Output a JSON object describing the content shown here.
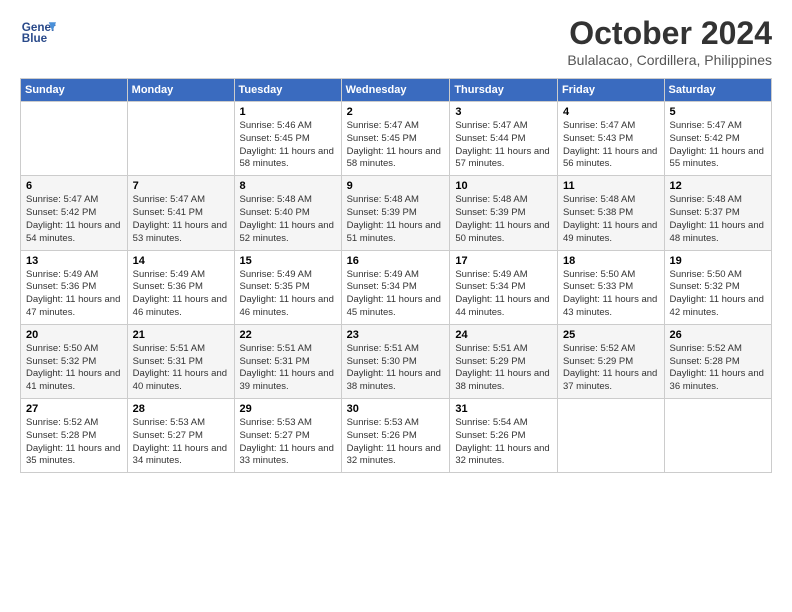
{
  "header": {
    "logo_line1": "General",
    "logo_line2": "Blue",
    "title": "October 2024",
    "location": "Bulalacao, Cordillera, Philippines"
  },
  "weekdays": [
    "Sunday",
    "Monday",
    "Tuesday",
    "Wednesday",
    "Thursday",
    "Friday",
    "Saturday"
  ],
  "weeks": [
    [
      {
        "day": "",
        "info": ""
      },
      {
        "day": "",
        "info": ""
      },
      {
        "day": "1",
        "info": "Sunrise: 5:46 AM\nSunset: 5:45 PM\nDaylight: 11 hours and 58 minutes."
      },
      {
        "day": "2",
        "info": "Sunrise: 5:47 AM\nSunset: 5:45 PM\nDaylight: 11 hours and 58 minutes."
      },
      {
        "day": "3",
        "info": "Sunrise: 5:47 AM\nSunset: 5:44 PM\nDaylight: 11 hours and 57 minutes."
      },
      {
        "day": "4",
        "info": "Sunrise: 5:47 AM\nSunset: 5:43 PM\nDaylight: 11 hours and 56 minutes."
      },
      {
        "day": "5",
        "info": "Sunrise: 5:47 AM\nSunset: 5:42 PM\nDaylight: 11 hours and 55 minutes."
      }
    ],
    [
      {
        "day": "6",
        "info": "Sunrise: 5:47 AM\nSunset: 5:42 PM\nDaylight: 11 hours and 54 minutes."
      },
      {
        "day": "7",
        "info": "Sunrise: 5:47 AM\nSunset: 5:41 PM\nDaylight: 11 hours and 53 minutes."
      },
      {
        "day": "8",
        "info": "Sunrise: 5:48 AM\nSunset: 5:40 PM\nDaylight: 11 hours and 52 minutes."
      },
      {
        "day": "9",
        "info": "Sunrise: 5:48 AM\nSunset: 5:39 PM\nDaylight: 11 hours and 51 minutes."
      },
      {
        "day": "10",
        "info": "Sunrise: 5:48 AM\nSunset: 5:39 PM\nDaylight: 11 hours and 50 minutes."
      },
      {
        "day": "11",
        "info": "Sunrise: 5:48 AM\nSunset: 5:38 PM\nDaylight: 11 hours and 49 minutes."
      },
      {
        "day": "12",
        "info": "Sunrise: 5:48 AM\nSunset: 5:37 PM\nDaylight: 11 hours and 48 minutes."
      }
    ],
    [
      {
        "day": "13",
        "info": "Sunrise: 5:49 AM\nSunset: 5:36 PM\nDaylight: 11 hours and 47 minutes."
      },
      {
        "day": "14",
        "info": "Sunrise: 5:49 AM\nSunset: 5:36 PM\nDaylight: 11 hours and 46 minutes."
      },
      {
        "day": "15",
        "info": "Sunrise: 5:49 AM\nSunset: 5:35 PM\nDaylight: 11 hours and 46 minutes."
      },
      {
        "day": "16",
        "info": "Sunrise: 5:49 AM\nSunset: 5:34 PM\nDaylight: 11 hours and 45 minutes."
      },
      {
        "day": "17",
        "info": "Sunrise: 5:49 AM\nSunset: 5:34 PM\nDaylight: 11 hours and 44 minutes."
      },
      {
        "day": "18",
        "info": "Sunrise: 5:50 AM\nSunset: 5:33 PM\nDaylight: 11 hours and 43 minutes."
      },
      {
        "day": "19",
        "info": "Sunrise: 5:50 AM\nSunset: 5:32 PM\nDaylight: 11 hours and 42 minutes."
      }
    ],
    [
      {
        "day": "20",
        "info": "Sunrise: 5:50 AM\nSunset: 5:32 PM\nDaylight: 11 hours and 41 minutes."
      },
      {
        "day": "21",
        "info": "Sunrise: 5:51 AM\nSunset: 5:31 PM\nDaylight: 11 hours and 40 minutes."
      },
      {
        "day": "22",
        "info": "Sunrise: 5:51 AM\nSunset: 5:31 PM\nDaylight: 11 hours and 39 minutes."
      },
      {
        "day": "23",
        "info": "Sunrise: 5:51 AM\nSunset: 5:30 PM\nDaylight: 11 hours and 38 minutes."
      },
      {
        "day": "24",
        "info": "Sunrise: 5:51 AM\nSunset: 5:29 PM\nDaylight: 11 hours and 38 minutes."
      },
      {
        "day": "25",
        "info": "Sunrise: 5:52 AM\nSunset: 5:29 PM\nDaylight: 11 hours and 37 minutes."
      },
      {
        "day": "26",
        "info": "Sunrise: 5:52 AM\nSunset: 5:28 PM\nDaylight: 11 hours and 36 minutes."
      }
    ],
    [
      {
        "day": "27",
        "info": "Sunrise: 5:52 AM\nSunset: 5:28 PM\nDaylight: 11 hours and 35 minutes."
      },
      {
        "day": "28",
        "info": "Sunrise: 5:53 AM\nSunset: 5:27 PM\nDaylight: 11 hours and 34 minutes."
      },
      {
        "day": "29",
        "info": "Sunrise: 5:53 AM\nSunset: 5:27 PM\nDaylight: 11 hours and 33 minutes."
      },
      {
        "day": "30",
        "info": "Sunrise: 5:53 AM\nSunset: 5:26 PM\nDaylight: 11 hours and 32 minutes."
      },
      {
        "day": "31",
        "info": "Sunrise: 5:54 AM\nSunset: 5:26 PM\nDaylight: 11 hours and 32 minutes."
      },
      {
        "day": "",
        "info": ""
      },
      {
        "day": "",
        "info": ""
      }
    ]
  ]
}
